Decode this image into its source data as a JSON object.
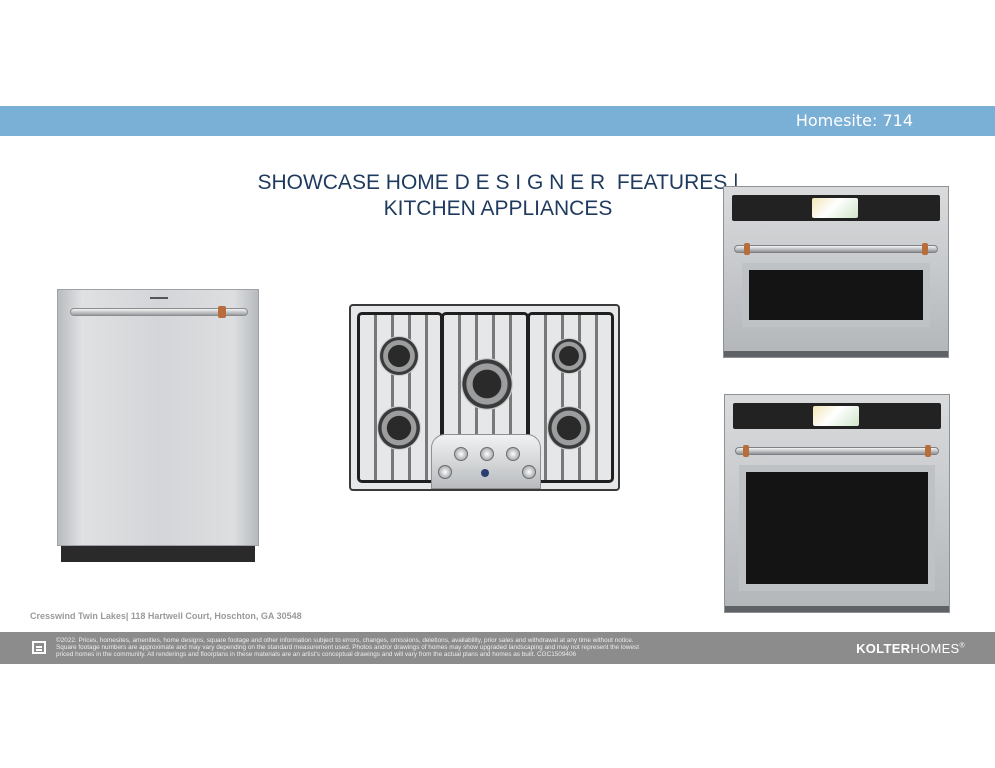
{
  "header": {
    "homesite": "Homesite: 714"
  },
  "title": {
    "line1": "SHOWCASE HOME D E S I G N E R  FEATURES |",
    "line2": "KITCHEN APPLIANCES"
  },
  "address": "Cresswind Twin Lakes| 118 Hartwell Court,  Hoschton, GA 30548",
  "footer": {
    "disclaimer_line1": "©2022. Prices, homesites, amenities, home designs, square footage and other information subject to errors, changes, omissions, deletions, availability, prior sales and withdrawal at any time without notice.",
    "disclaimer_line2": "Square footage numbers are approximate and may vary depending on the standard measurement used. Photos and/or drawings of homes may show upgraded landscaping and may not represent the lowest",
    "disclaimer_line3": "priced homes in the community. All renderings and floorplans in these materials are an artist's conceptual drawings and will vary from the actual plans and homes as built. CGC1509406",
    "brand_bold": "KOLTER",
    "brand_light": "HOMES",
    "brand_mark": "®"
  },
  "colors": {
    "band": "#7aafd6",
    "title": "#1f3a5f",
    "footer": "#8c8c8c",
    "copper": "#b86d3d"
  },
  "icons": {
    "equal_housing": "equal-housing-icon"
  }
}
